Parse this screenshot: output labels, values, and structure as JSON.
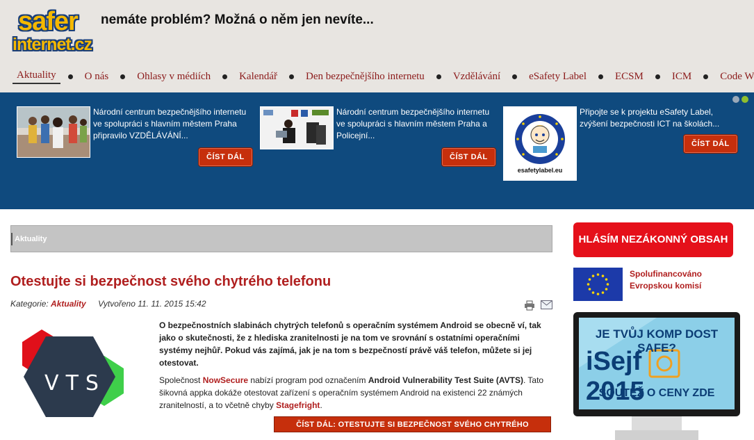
{
  "header": {
    "logo_line1": "safer",
    "logo_line2": "internet.cz",
    "slogan": "nemáte problém? Možná o něm jen nevíte..."
  },
  "nav": {
    "items": [
      {
        "label": "Aktuality",
        "active": true
      },
      {
        "label": "O nás"
      },
      {
        "label": "Ohlasy v médiích"
      },
      {
        "label": "Kalendář"
      },
      {
        "label": "Den bezpečnějšího internetu"
      },
      {
        "label": "Vzdělávání"
      },
      {
        "label": "eSafety Label"
      },
      {
        "label": "ECSM"
      },
      {
        "label": "ICM"
      },
      {
        "label": "Code Week"
      }
    ]
  },
  "slider": {
    "slides": [
      {
        "text": "Národní centrum bezpečnějšího internetu ve spolupráci s hlavním městem Praha připravilo VZDĚLÁVÁNÍ...",
        "button": "ČÍST DÁL"
      },
      {
        "text": "Národní centrum bezpečnějšího internetu ve spolupráci s hlavním městem Praha a Policejní...",
        "button": "ČÍST DÁL"
      },
      {
        "text": "Připojte se k projektu eSafety Label, zvýšení bezpečnosti ICT na školách...",
        "button": "ČÍST DÁL",
        "thumb_caption": "esafetylabel.eu"
      }
    ]
  },
  "breadcrumb": "Aktuality",
  "article": {
    "title": "Otestujte si bezpečnost svého chytrého telefonu",
    "category_label": "Kategorie:",
    "category": "Aktuality",
    "created": "Vytvořeno 11. 11. 2015 15:42",
    "image_text": "VTS",
    "intro": "O bezpečnostních slabinách chytrých telefonů s operačním systémem Android se obecně ví, tak jako o skutečnosti, že z hlediska zranitelnosti je na tom ve srovnání s ostatními operačními systémy nejhůř. Pokud vás zajímá, jak je na tom s bezpečností právě váš telefon, můžete si jej otestovat.",
    "body_1": "Společnost ",
    "body_company": "NowSecure",
    "body_2": " nabízí program pod označením ",
    "body_program": "Android Vulnerability Test Suite (AVTS)",
    "body_3": ". Tato šikovná appka dokáže otestovat zařízení s operačním systémem Android na existenci 22 známých zranitelností, a to včetně chyby ",
    "body_bug": "Stagefright",
    "body_4": ".",
    "read_more": "ČÍST DÁL: OTESTUJTE SI BEZPEČNOST SVÉHO CHYTRÉHO TELEFONU"
  },
  "sidebar": {
    "report_button": "HLÁSÍM NEZÁKONNÝ OBSAH",
    "eu_line1": "Spolufinancováno",
    "eu_line2": "Evropskou komisí",
    "isejf_line1": "JE TVŮJ KOMP DOST SAFE?",
    "isejf_line2": "iSejf",
    "isejf_year": "2015",
    "isejf_line3": "SOUTĚŽ O CENY ZDE"
  },
  "colors": {
    "accent_red": "#b01f1f",
    "button_red": "#c62f0c",
    "slider_blue": "#0f4a7e",
    "header_bg": "#e8e5e1"
  }
}
